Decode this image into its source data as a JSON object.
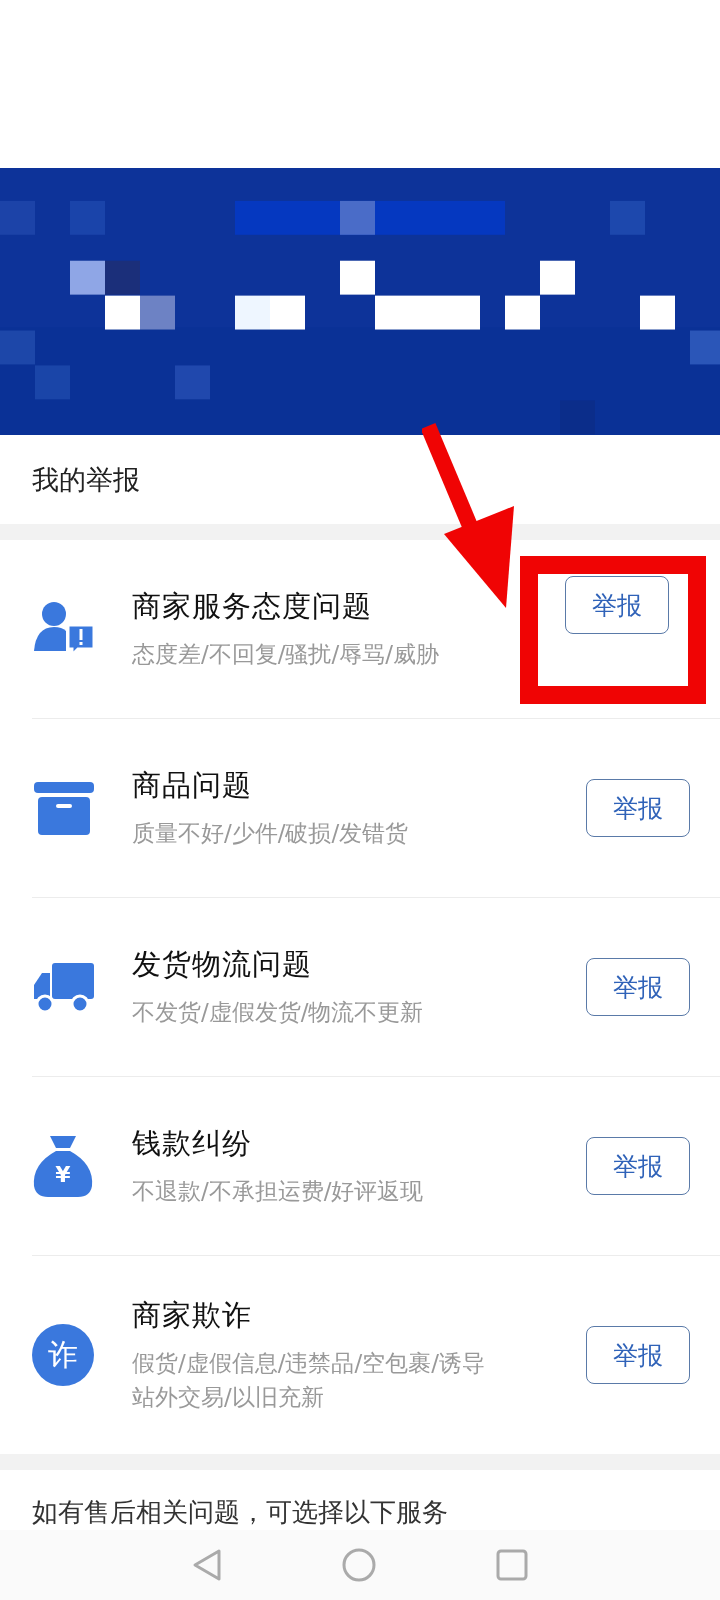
{
  "section_title": "我的举报",
  "items": [
    {
      "kind": "person-alert",
      "title": "商家服务态度问题",
      "subtitle": "态度差/不回复/骚扰/辱骂/威胁",
      "button": "举报",
      "highlighted": true
    },
    {
      "kind": "box",
      "title": "商品问题",
      "subtitle": "质量不好/少件/破损/发错货",
      "button": "举报",
      "highlighted": false
    },
    {
      "kind": "truck",
      "title": "发货物流问题",
      "subtitle": "不发货/虚假发货/物流不更新",
      "button": "举报",
      "highlighted": false
    },
    {
      "kind": "money-bag",
      "title": "钱款纠纷",
      "subtitle": "不退款/不承担运费/好评返现",
      "button": "举报",
      "highlighted": false,
      "glyph": "¥"
    },
    {
      "kind": "fraud",
      "title": "商家欺诈",
      "subtitle": "假货/虚假信息/违禁品/空包裹/诱导站外交易/以旧充新",
      "button": "举报",
      "highlighted": false,
      "glyph": "诈"
    }
  ],
  "footer_text": "如有售后相关问题，可选择以下服务"
}
